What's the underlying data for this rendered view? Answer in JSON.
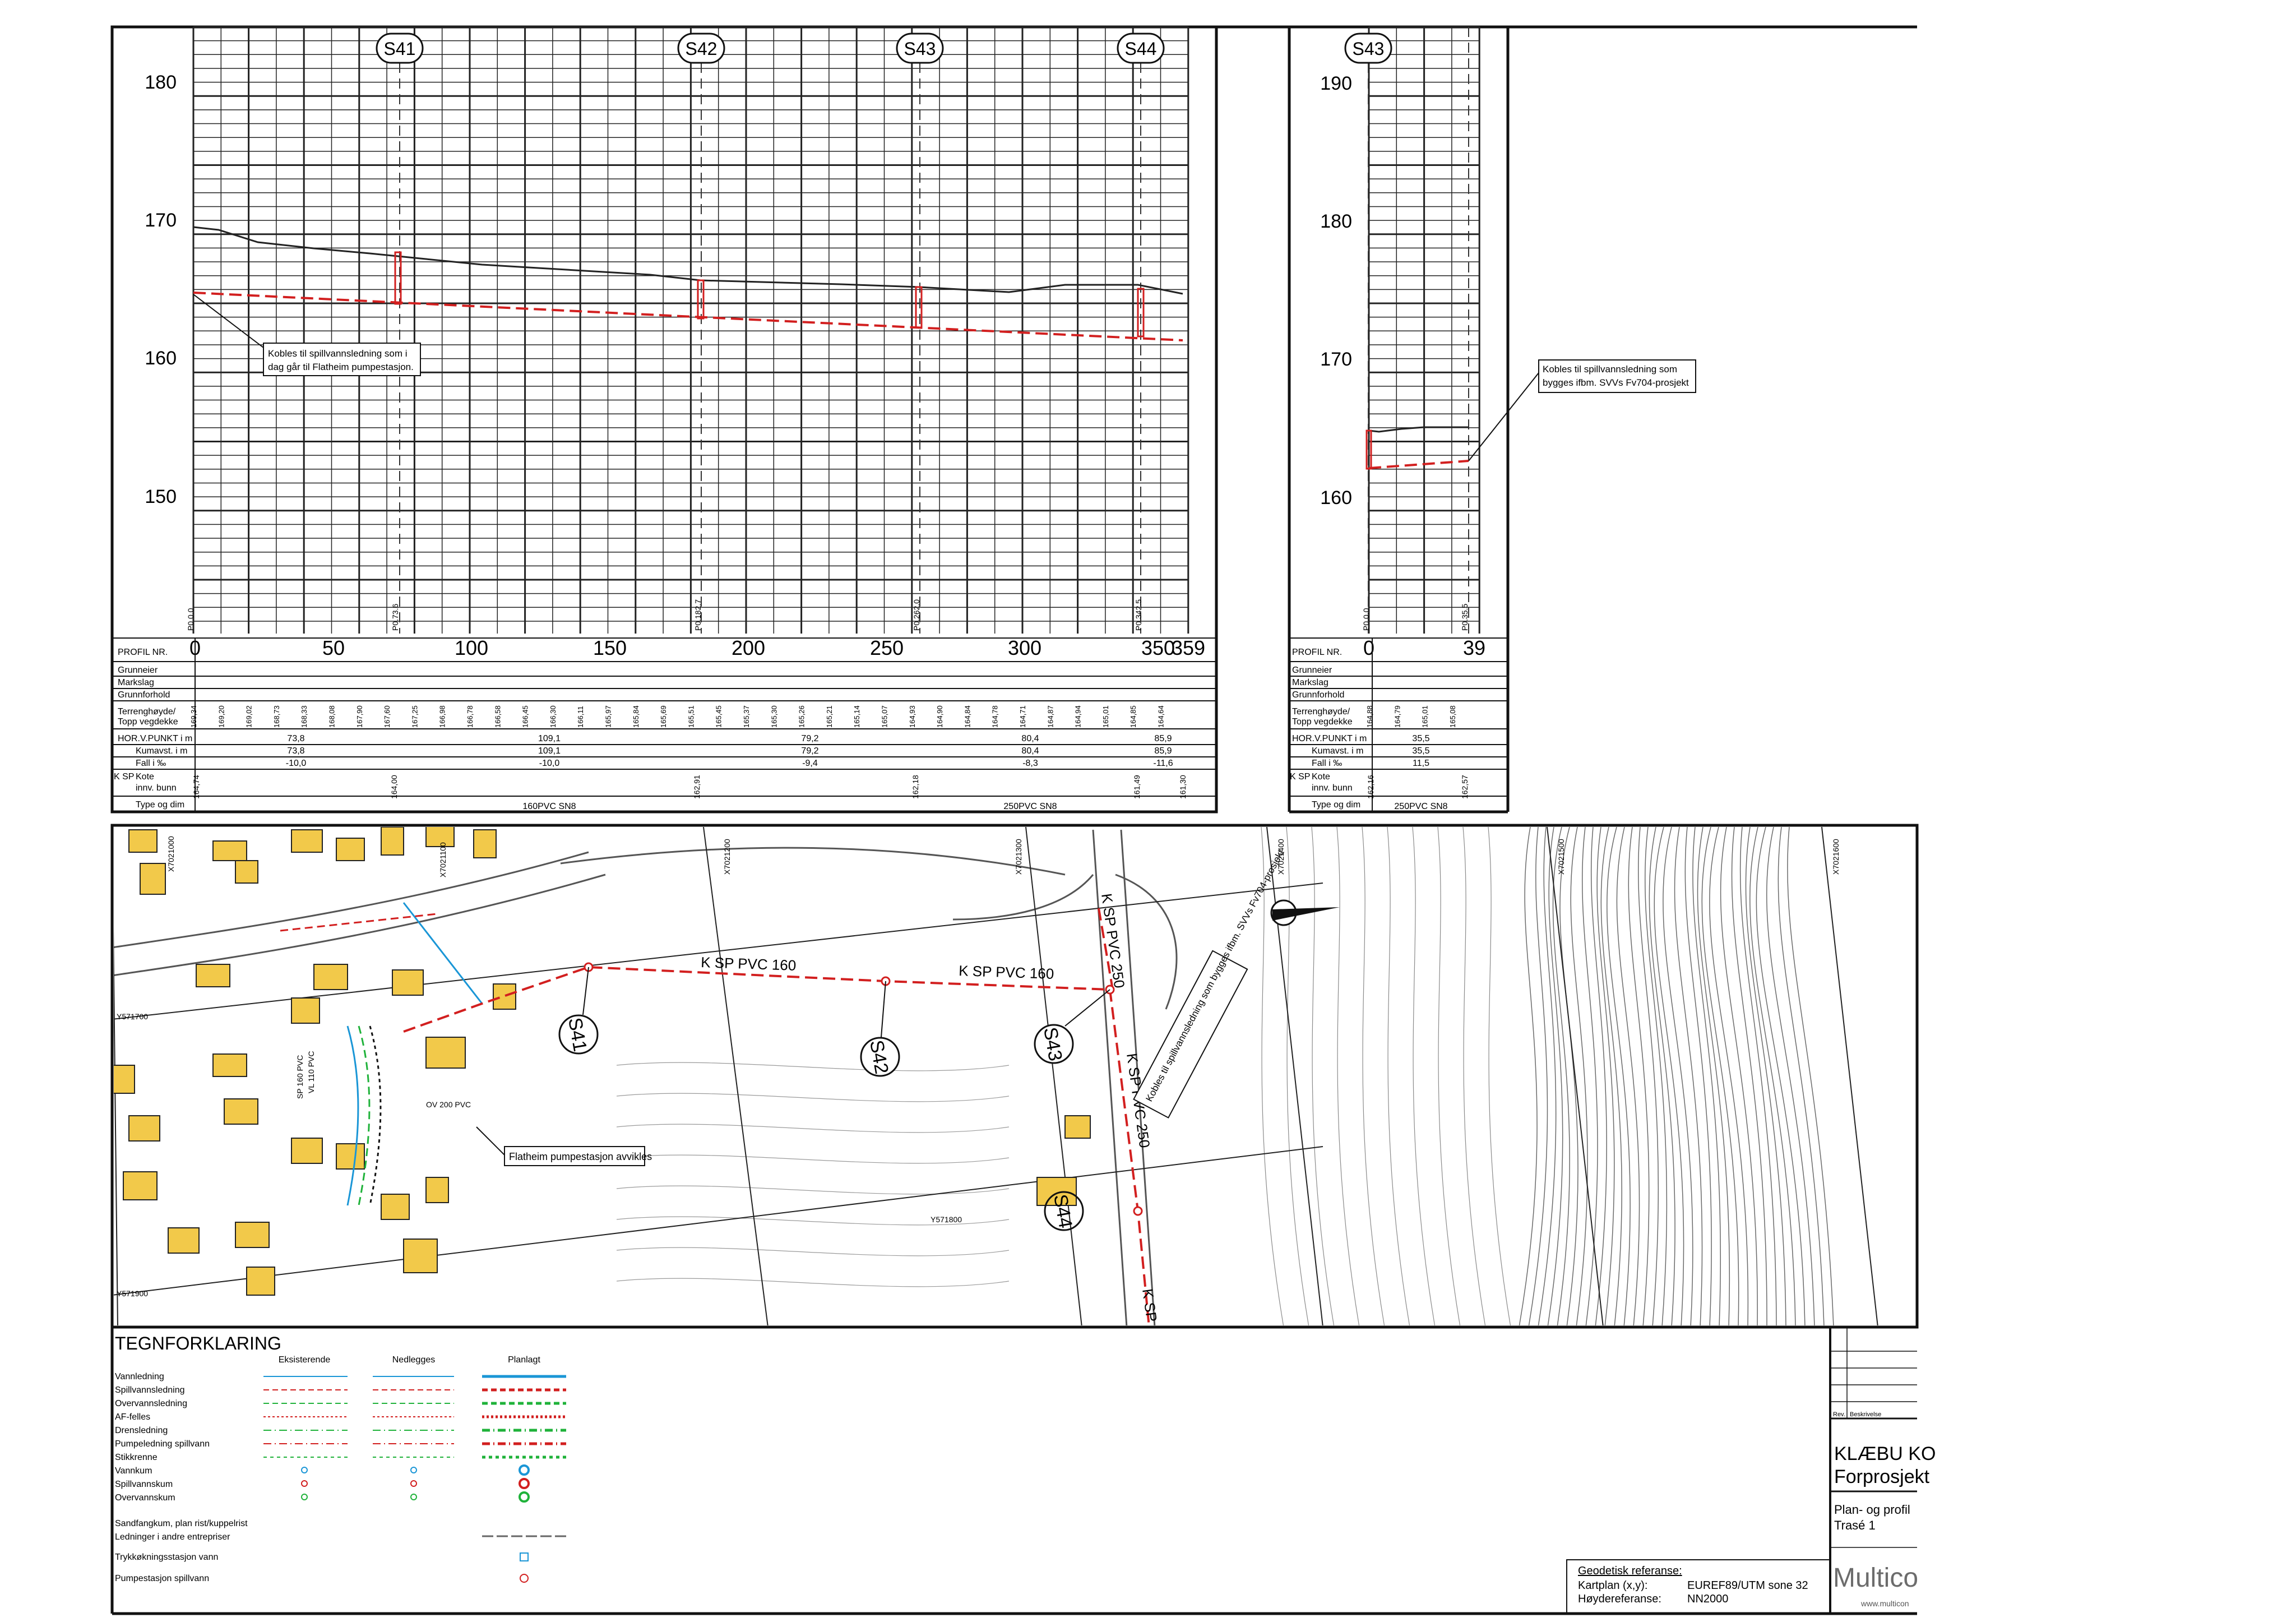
{
  "profile_left": {
    "stations": [
      "S41",
      "S42",
      "S43",
      "S44"
    ],
    "y_ticks": [
      "180",
      "170",
      "160",
      "150"
    ],
    "x_ticks": [
      "0",
      "50",
      "100",
      "150",
      "200",
      "250",
      "300",
      "350",
      "359"
    ],
    "vertical_labels": [
      "P0.0.0",
      "P0.73.6",
      "P0.182.7",
      "P0.262.0",
      "P0.342.5"
    ],
    "annotation_l1": "Kobles til spillvannsledning som i",
    "annotation_l2": "dag går til Flatheim pumpestasjon."
  },
  "profile_right": {
    "stations": [
      "S43"
    ],
    "y_ticks": [
      "190",
      "180",
      "170",
      "160"
    ],
    "x_ticks": [
      "0",
      "39"
    ],
    "vertical_labels": [
      "P0.0.0",
      "P0.35.5"
    ],
    "annotation_l1": "Kobles til spillvannsledning som",
    "annotation_l2": "bygges ifbm. SVVs Fv704-prosjekt"
  },
  "table": {
    "row_labels": [
      "PROFIL NR.",
      "Grunneier",
      "Markslag",
      "Grunnforhold",
      "Terrenghøyde/",
      "Topp vegdekke",
      "HOR.V.PUNKT i m",
      "Kumavst. i m",
      "Fall i ‰",
      "Kote",
      "innv. bunn",
      "Type og dim"
    ],
    "ksp": "K SP",
    "left_terrain": [
      "169,34",
      "169,20",
      "169,02",
      "168,73",
      "168,33",
      "168,08",
      "167,90",
      "167,60",
      "167,25",
      "166,98",
      "166,78",
      "166,58",
      "166,45",
      "166,30",
      "166,11",
      "165,97",
      "165,84",
      "165,69",
      "165,51",
      "165,45",
      "165,37",
      "165,30",
      "165,26",
      "165,21",
      "165,14",
      "165,07",
      "164,93",
      "164,90",
      "164,84",
      "164,78",
      "164,71",
      "164,87",
      "164,94",
      "165,01",
      "164,85",
      "164,64"
    ],
    "left_hor": [
      "73,8",
      "109,1",
      "79,2",
      "80,4",
      "85,9"
    ],
    "left_kum": [
      "73,8",
      "109,1",
      "79,2",
      "80,4",
      "85,9"
    ],
    "left_fall": [
      "-10,0",
      "-10,0",
      "-9,4",
      "-8,3",
      "-11,6"
    ],
    "left_kote": [
      "164,74",
      "164,00",
      "162,91",
      "162,18",
      "161,49",
      "161,30"
    ],
    "left_type": [
      "160PVC SN8",
      "250PVC SN8"
    ],
    "right_terrain": [
      "164,88",
      "164,79",
      "165,01",
      "165,08"
    ],
    "right_hor": "35,5",
    "right_kum": "35,5",
    "right_fall": "11,5",
    "right_kote": [
      "162,16",
      "162,57"
    ],
    "right_type": "250PVC SN8"
  },
  "map": {
    "pipe_labels": [
      "K SP PVC 160",
      "K SP PVC 160",
      "K SP PVC 250",
      "K SP PVC 250",
      "K SP"
    ],
    "manholes": [
      "S41",
      "S42",
      "S43",
      "S44"
    ],
    "grid_labels": [
      "Y571700",
      "Y571800",
      "Y571900",
      "X7021000",
      "X7021100",
      "X7021200",
      "X7021300",
      "X7021400",
      "X7021500",
      "X7021600"
    ],
    "callout_flatheim": "Flatheim pumpestasjon avvikles",
    "callout_ref": "Kobles til spillvannsledning som bygges ifbm. SVVs Fv704-prosjekt",
    "small_labels": [
      "OV 200 PVC",
      "SP 160 PVC",
      "VL 110 PVC"
    ]
  },
  "legend": {
    "title": "TEGNFORKLARING",
    "columns": [
      "Eksisterende",
      "Nedlegges",
      "Planlagt"
    ],
    "rows": [
      "Vannledning",
      "Spillvannsledning",
      "Overvannsledning",
      "AF-felles",
      "Drensledning",
      "Pumpeledning spillvann",
      "Stikkrenne",
      "Vannkum",
      "Spillvannskum",
      "Overvannskum"
    ],
    "rows2": [
      "Sandfangkum, plan rist/kuppelrist",
      "Ledninger i andre entrepriser",
      "Trykkøkningsstasjon vann",
      "Pumpestasjon spillvann"
    ]
  },
  "geo": {
    "title": "Geodetisk referanse:",
    "k1": "Kartplan (x,y):",
    "v1": "EUREF89/UTM sone 32",
    "k2": "Høydereferanse:",
    "v2": "NN2000"
  },
  "title_block": {
    "rev": "Rev.",
    "desc": "Beskrivelse",
    "client": "KLÆBU KO",
    "project": "Forprosjekt",
    "drawing": "Plan- og profil",
    "route": "Trasé 1",
    "company": "Multico",
    "web": "www.multicon"
  },
  "colors": {
    "red": "#d21f1f",
    "blue": "#1a96d6",
    "green": "#1fb23a",
    "house": "#f2c94a",
    "grid": "#222222"
  }
}
